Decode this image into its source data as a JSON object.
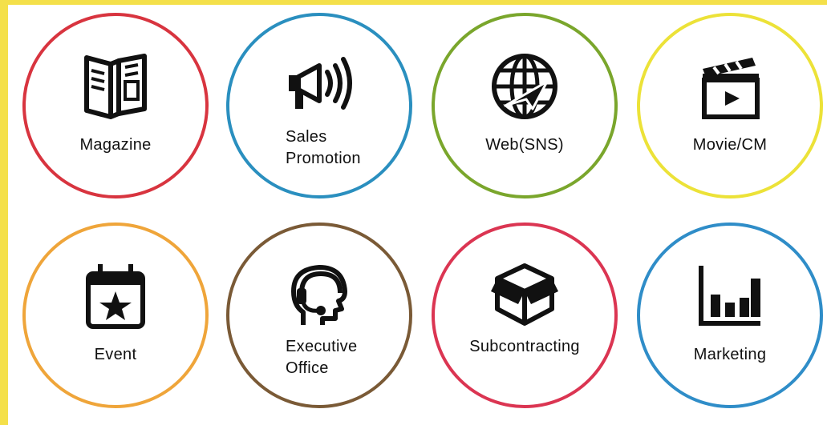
{
  "services": [
    {
      "label": "Magazine",
      "icon": "magazine-icon",
      "color": "#d8343f"
    },
    {
      "label": "Sales\nPromotion",
      "icon": "megaphone-icon",
      "color": "#2a8fbf"
    },
    {
      "label": "Web(SNS)",
      "icon": "globe-icon",
      "color": "#7aa62c"
    },
    {
      "label": "Movie/CM",
      "icon": "clapperboard-icon",
      "color": "#ece238"
    },
    {
      "label": "Event",
      "icon": "calendar-star-icon",
      "color": "#efa53a"
    },
    {
      "label": "Executive\nOffice",
      "icon": "headset-icon",
      "color": "#7a5a36"
    },
    {
      "label": "Subcontracting",
      "icon": "box-icon",
      "color": "#db3552"
    },
    {
      "label": "Marketing",
      "icon": "bar-chart-icon",
      "color": "#2f8dc8"
    }
  ]
}
